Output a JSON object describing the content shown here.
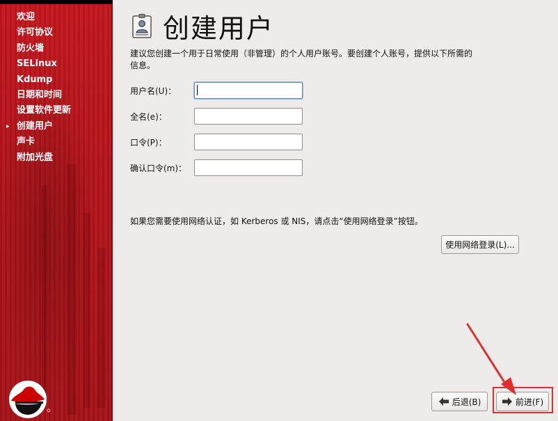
{
  "sidebar": {
    "items": [
      {
        "label": "欢迎",
        "current": false
      },
      {
        "label": "许可协议",
        "current": false
      },
      {
        "label": "防火墙",
        "current": false
      },
      {
        "label": "SELinux",
        "current": false
      },
      {
        "label": "Kdump",
        "current": false
      },
      {
        "label": "日期和时间",
        "current": false
      },
      {
        "label": "设置软件更新",
        "current": false
      },
      {
        "label": "创建用户",
        "current": true
      },
      {
        "label": "声卡",
        "current": false
      },
      {
        "label": "附加光盘",
        "current": false
      }
    ],
    "current_marker": "▸"
  },
  "header": {
    "title": "创建用户",
    "icon": "user-id-card-icon"
  },
  "intro_text": "建议您创建一个用于日常使用（非管理）的个人用户账号。要创建个人账号，提供以下所需的信息。",
  "form": {
    "username_label": "用户名(U)：",
    "fullname_label": "全名(e)：",
    "password_label": "口令(P)：",
    "confirm_label": "确认口令(m)：",
    "username_value": "",
    "fullname_value": "",
    "password_value": "",
    "confirm_value": ""
  },
  "network_note": "如果您需要使用网络认证，如 Kerberos 或 NIS，请点击“使用网络登录”按钮。",
  "buttons": {
    "network_login": "使用网络登录(L)...",
    "back": "后退(B)",
    "next": "前进(F)"
  },
  "colors": {
    "sidebar_red": "#b3141a",
    "panel_bg": "#edeceb",
    "annotation_red": "#e0302b"
  }
}
